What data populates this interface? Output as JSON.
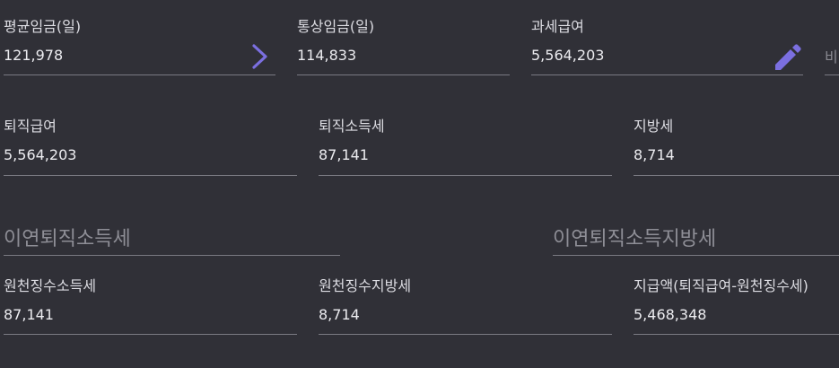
{
  "row1": {
    "avg_wage": {
      "label": "평균임금(일)",
      "value": "121,978"
    },
    "normal_wage": {
      "label": "통상임금(일)",
      "value": "114,833"
    },
    "taxable_pay": {
      "label": "과세급여",
      "value": "5,564,203"
    },
    "cutoff_field": {
      "value": "비"
    }
  },
  "row2": {
    "severance_pay": {
      "label": "퇴직급여",
      "value": "5,564,203"
    },
    "retirement_income_tax": {
      "label": "퇴직소득세",
      "value": "87,141"
    },
    "local_tax": {
      "label": "지방세",
      "value": "8,714"
    }
  },
  "row3": {
    "deferred_retirement_income_tax": {
      "placeholder": "이연퇴직소득세"
    },
    "deferred_retirement_local_tax": {
      "placeholder": "이연퇴직소득지방세"
    }
  },
  "row4": {
    "withholding_income_tax": {
      "label": "원천징수소득세",
      "value": "87,141"
    },
    "withholding_local_tax": {
      "label": "원천징수지방세",
      "value": "8,714"
    },
    "payment_amount": {
      "label": "지급액(퇴직급여-원천징수세)",
      "value": "5,468,348"
    }
  },
  "colors": {
    "background": "#303037",
    "accent": "#7b6fe0",
    "underline": "#7a7a82"
  },
  "icons": {
    "avg_wage_action": "chevron-right-icon",
    "taxable_pay_action": "pencil-icon"
  }
}
